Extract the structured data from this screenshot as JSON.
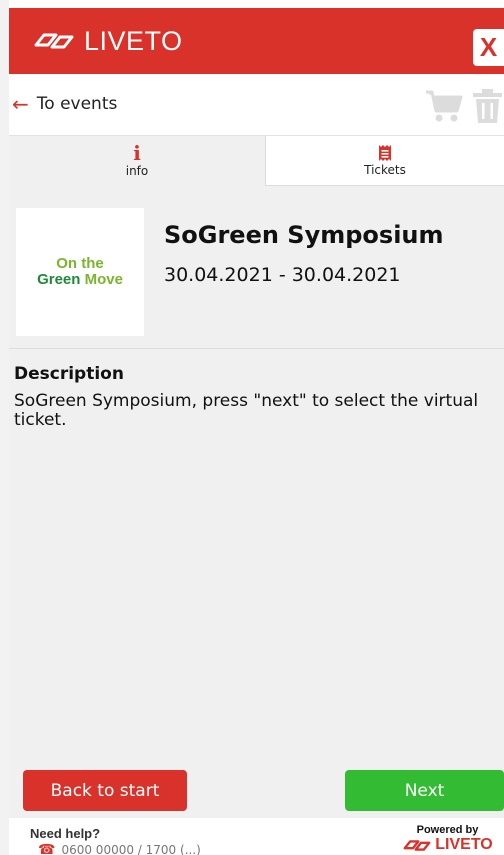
{
  "header": {
    "brand_name": "LIVETO",
    "close_label": "X",
    "brand_color": "#d9322b",
    "logo_icon": "liveto-chain-icon"
  },
  "nav": {
    "back_label": "To events",
    "back_icon": "arrow-left-icon",
    "cart_icon": "cart-icon",
    "trash_icon": "trash-icon"
  },
  "tabs": [
    {
      "label": "info",
      "icon": "info-icon",
      "active": true
    },
    {
      "label": "Tickets",
      "icon": "ticket-icon",
      "active": false
    }
  ],
  "event": {
    "logo_line1": "On the",
    "logo_line2_a": "Green",
    "logo_line2_b": " Move",
    "title": "SoGreen Symposium",
    "date_range": "30.04.2021 - 30.04.2021"
  },
  "description": {
    "heading": "Description",
    "text": "SoGreen Symposium, press \"next\" to select the virtual ticket."
  },
  "buttons": {
    "back_to_start": "Back to start",
    "next": "Next",
    "back_color": "#d9322b",
    "next_color": "#33bb33"
  },
  "footer": {
    "help_label": "Need help?",
    "phone_text": "0600 00000 / 1700 (...)",
    "powered_label": "Powered by",
    "powered_brand": "LIVETO"
  }
}
